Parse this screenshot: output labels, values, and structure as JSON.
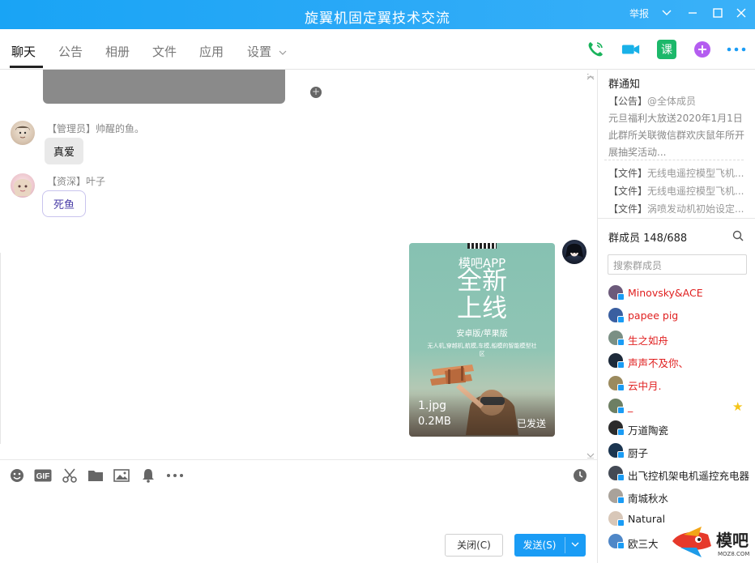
{
  "window": {
    "title": "旋翼机固定翼技术交流",
    "report_label": "举报"
  },
  "tabs": [
    {
      "label": "聊天"
    },
    {
      "label": "公告"
    },
    {
      "label": "相册"
    },
    {
      "label": "文件"
    },
    {
      "label": "应用"
    },
    {
      "label": "设置"
    }
  ],
  "chat": {
    "messages": [
      {
        "sender": "【管理员】帅醒的鱼。",
        "text": "真爱"
      },
      {
        "sender": "【资深】叶子",
        "text": "死鱼"
      }
    ],
    "image_message": {
      "poster_line1": "模吧APP",
      "poster_line2": "全新",
      "poster_line3": "上线",
      "poster_line4": "安卓版/苹果版",
      "poster_line5": "无人机,穿越机,航模,车模,船模的智能模型社区",
      "file_name": "1.jpg",
      "file_size": "0.2MB",
      "status": "已发送"
    }
  },
  "input": {
    "close_label": "关闭(C)",
    "send_label": "发送(S)"
  },
  "right_panel": {
    "notice_title": "群通知",
    "notice_tag": "【公告】",
    "notice_mention": "@全体成员",
    "notice_line1": "元旦福利大放送2020年1月1日",
    "notice_line2": "此群所关联微信群欢庆鼠年所开",
    "notice_line3": "展抽奖活动...",
    "files": [
      {
        "tag": "【文件】",
        "name": "无线电遥控模型飞机..."
      },
      {
        "tag": "【文件】",
        "name": "无线电遥控模型飞机..."
      },
      {
        "tag": "【文件】",
        "name": "涡喷发动机初始设定..."
      }
    ],
    "members_title": "群成员 148/688",
    "search_placeholder": "搜索群成员",
    "members": [
      {
        "name": "Minovsky&ACE",
        "color": "#e02020",
        "avatar_color": "#6c5a7a"
      },
      {
        "name": "papee pig",
        "color": "#e02020",
        "avatar_color": "#3a5fa0"
      },
      {
        "name": "生之如舟",
        "color": "#e02020",
        "avatar_color": "#7a8f84"
      },
      {
        "name": "声声不及你、",
        "color": "#e02020",
        "avatar_color": "#1d2a3a"
      },
      {
        "name": "云中月.",
        "color": "#e02020",
        "avatar_color": "#9b8a5e"
      },
      {
        "name": "_",
        "color": "#e02020",
        "avatar_color": "#6d7f63"
      },
      {
        "name": "万道陶瓷",
        "color": "#222222",
        "avatar_color": "#2b2b2b"
      },
      {
        "name": "厨子",
        "color": "#222222",
        "avatar_color": "#1b3550"
      },
      {
        "name": "出飞控机架电机遥控充电器",
        "color": "#222222",
        "avatar_color": "#444a55"
      },
      {
        "name": "南城秋水",
        "color": "#222222",
        "avatar_color": "#a9a29a"
      },
      {
        "name": "Natural",
        "color": "#222222",
        "avatar_color": "#d8c7b8"
      },
      {
        "name": "欧三大",
        "color": "#222222",
        "avatar_color": "#4f87c7"
      }
    ]
  },
  "watermark": {
    "brand": "模吧",
    "url": "MOZ8.COM"
  },
  "colors": {
    "titlebar": "#1ba5f5",
    "accent": "#1a9cf5",
    "admin_name": "#e02020"
  }
}
